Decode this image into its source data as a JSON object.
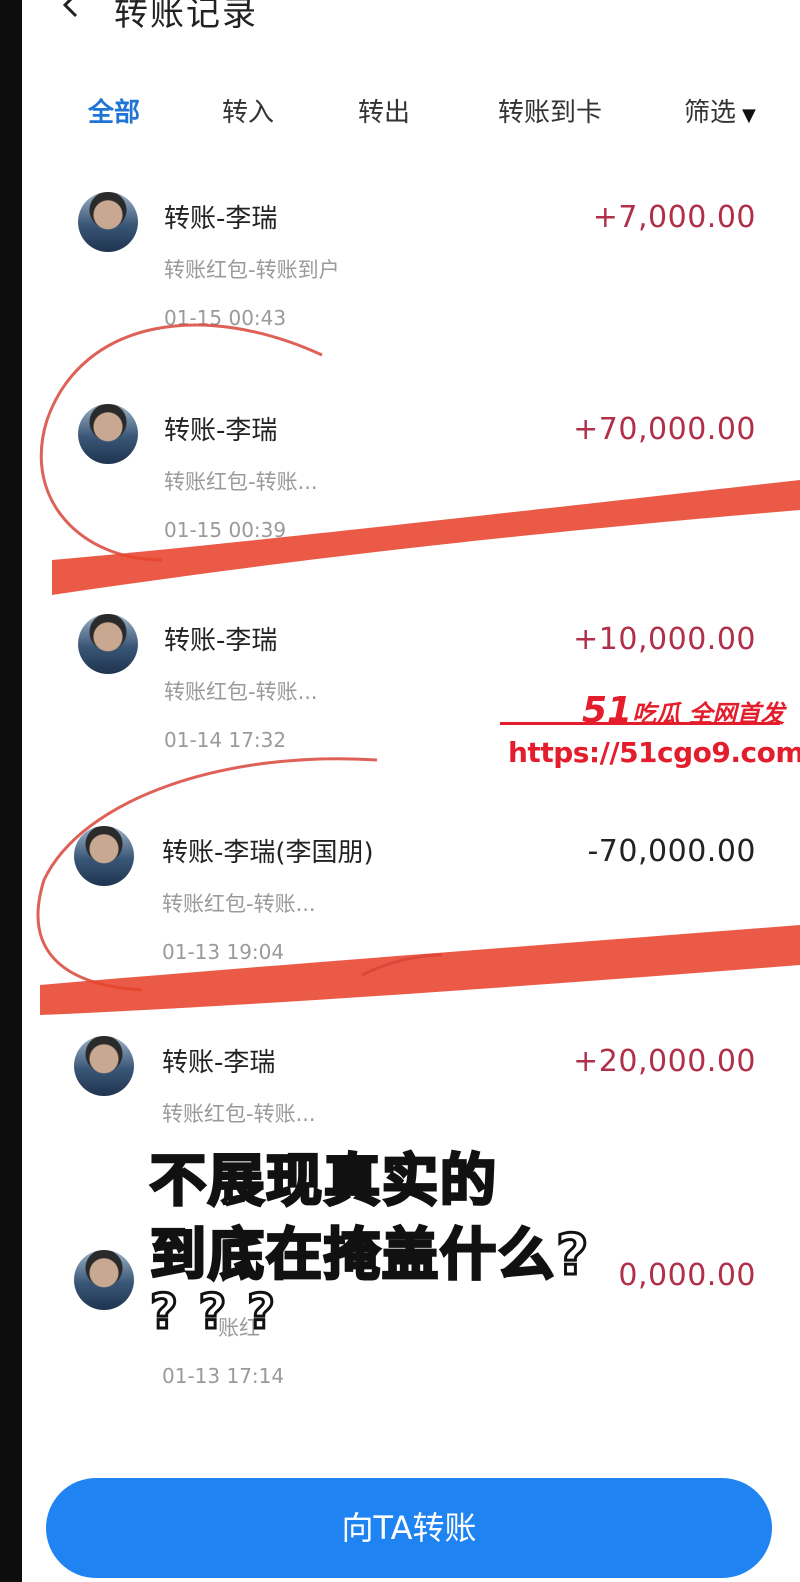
{
  "header": {
    "title": "转账记录"
  },
  "tabs": [
    {
      "label": "全部",
      "active": true
    },
    {
      "label": "转入"
    },
    {
      "label": "转出"
    },
    {
      "label": "转账到卡"
    },
    {
      "label": "筛选"
    }
  ],
  "records": [
    {
      "name": "转账-李瑞",
      "sub": "转账红包-转账到户",
      "time": "01-15 00:43",
      "amount": "+7,000.00"
    },
    {
      "name": "转账-李瑞",
      "sub": "转账红包-转账...",
      "time": "01-15 00:39",
      "amount": "+70,000.00"
    },
    {
      "name": "转账-李瑞",
      "sub": "转账红包-转账...",
      "time": "01-14 17:32",
      "amount": "+10,000.00"
    },
    {
      "name": "转账-李瑞(李国朋)",
      "sub": "转账红包-转账...",
      "time": "01-13 19:04",
      "amount": "-70,000.00"
    },
    {
      "name": "转账-李瑞",
      "sub": "转账红包-转账...",
      "time": "",
      "amount": "+20,000.00"
    },
    {
      "name": "",
      "sub": "账红",
      "time": "01-13 17:14",
      "amount": "0,000.00"
    }
  ],
  "watermark": {
    "logo_num": "51",
    "logo_text": "吃瓜 全网首发",
    "url": "https://51cgo9.com"
  },
  "caption": {
    "line1": "不展现真实的",
    "line2": "到底在掩盖什么?",
    "line3": "? ? ?"
  },
  "button": {
    "label": "向TA转账"
  },
  "colors": {
    "accent": "#1f84f2",
    "income": "#b0304a",
    "annotation": "#e8432c"
  }
}
